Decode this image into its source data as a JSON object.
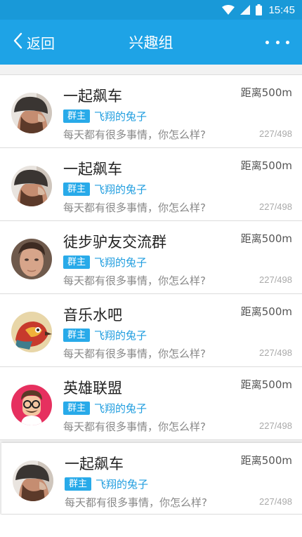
{
  "status_bar": {
    "time": "15:45",
    "icons": [
      "wifi-icon",
      "signal-icon",
      "battery-icon"
    ]
  },
  "header": {
    "back_label": "返回",
    "title": "兴趣组",
    "more_icon": "more-dots-icon"
  },
  "colors": {
    "status_bar": "#1999d8",
    "header": "#1ea3e6",
    "badge": "#28aae9",
    "owner_name": "#1f9ddf"
  },
  "groups": [
    {
      "name": "一起飙车",
      "distance": "距离500m",
      "owner_badge": "群主",
      "owner_name": "飞翔的兔子",
      "description": "每天都有很多事情，你怎么样?",
      "members": "227/498",
      "avatar": "beanie-man-avatar"
    },
    {
      "name": "一起飙车",
      "distance": "距离500m",
      "owner_badge": "群主",
      "owner_name": "飞翔的兔子",
      "description": "每天都有很多事情，你怎么样?",
      "members": "227/498",
      "avatar": "beanie-man-avatar"
    },
    {
      "name": "徒步驴友交流群",
      "distance": "距离500m",
      "owner_badge": "群主",
      "owner_name": "飞翔的兔子",
      "description": "每天都有很多事情，你怎么样?",
      "members": "227/498",
      "avatar": "young-man-avatar"
    },
    {
      "name": "音乐水吧",
      "distance": "距离500m",
      "owner_badge": "群主",
      "owner_name": "飞翔的兔子",
      "description": "每天都有很多事情，你怎么样?",
      "members": "227/498",
      "avatar": "bird-avatar"
    },
    {
      "name": "英雄联盟",
      "distance": "距离500m",
      "owner_badge": "群主",
      "owner_name": "飞翔的兔子",
      "description": "每天都有很多事情，你怎么样?",
      "members": "227/498",
      "avatar": "cartoon-man-avatar"
    },
    {
      "name": "一起飙车",
      "distance": "距离500m",
      "owner_badge": "群主",
      "owner_name": "飞翔的兔子",
      "description": "每天都有很多事情，你怎么样?",
      "members": "227/498",
      "avatar": "beanie-man-avatar"
    }
  ]
}
